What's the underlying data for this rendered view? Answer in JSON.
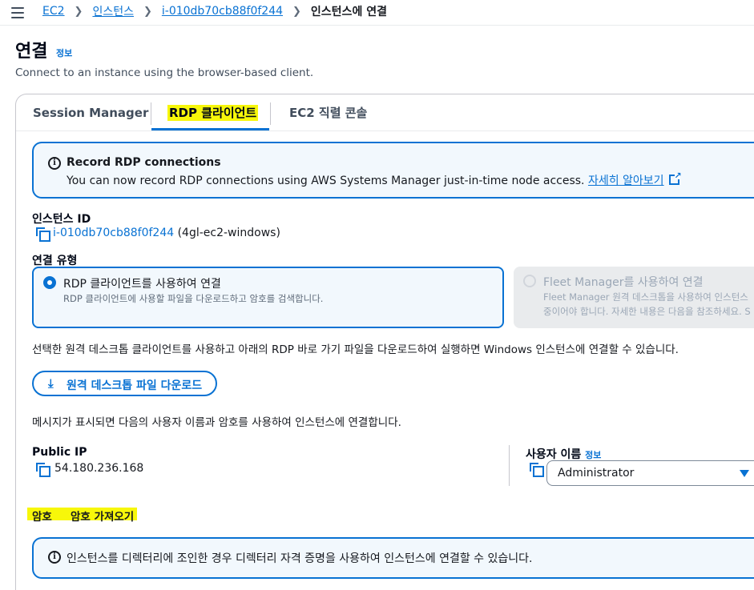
{
  "breadcrumb": {
    "items": [
      "EC2",
      "인스턴스",
      "i-010db70cb88f0f244"
    ],
    "current": "인스턴스에 연결"
  },
  "header": {
    "title": "연결",
    "info": "정보",
    "subtitle": "Connect to an instance using the browser-based client."
  },
  "tabs": [
    {
      "label": "Session Manager"
    },
    {
      "label": "RDP 클라이언트"
    },
    {
      "label": "EC2 직렬 콘솔"
    }
  ],
  "alert": {
    "title": "Record RDP connections",
    "text": "You can now record RDP connections using AWS Systems Manager just-in-time node access. ",
    "link": "자세히 알아보기"
  },
  "instance": {
    "label": "인스턴스 ID",
    "id": "i-010db70cb88f0f244",
    "name": "(4gl-ec2-windows)"
  },
  "connection_type": {
    "label": "연결 유형",
    "options": [
      {
        "title": "RDP 클라이언트를 사용하여 연결",
        "desc": "RDP 클라이언트에 사용할 파일을 다운로드하고 암호를 검색합니다."
      },
      {
        "title": "Fleet Manager를 사용하여 연결",
        "desc1": "Fleet Manager 원격 데스크톱을 사용하여 인스턴스",
        "desc2": "중이어야 합니다. 자세한 내용은 다음을 참조하세요. S"
      }
    ]
  },
  "instructions": "선택한 원격 데스크톱 클라이언트를 사용하고 아래의 RDP 바로 가기 파일을 다운로드하여 실행하면 Windows 인스턴스에 연결할 수 있습니다.",
  "download_button": "원격 데스크톱 파일 다운로드",
  "prompt_text": "메시지가 표시되면 다음의 사용자 이름과 암호를 사용하여 인스턴스에 연결합니다.",
  "public_ip": {
    "label": "Public IP",
    "value": "54.180.236.168"
  },
  "username": {
    "label": "사용자 이름",
    "info": "정보",
    "value": "Administrator"
  },
  "password": {
    "label": "암호",
    "action": "암호 가져오기"
  },
  "domain_alert": {
    "text": "인스턴스를 디렉터리에 조인한 경우 디렉터리 자격 증명을 사용하여 인스턴스에 연결할 수 있습니다."
  },
  "colors": {
    "accent": "#0972d3",
    "highlight": "#f7f70a",
    "alert_bg": "#f2f8fd"
  }
}
